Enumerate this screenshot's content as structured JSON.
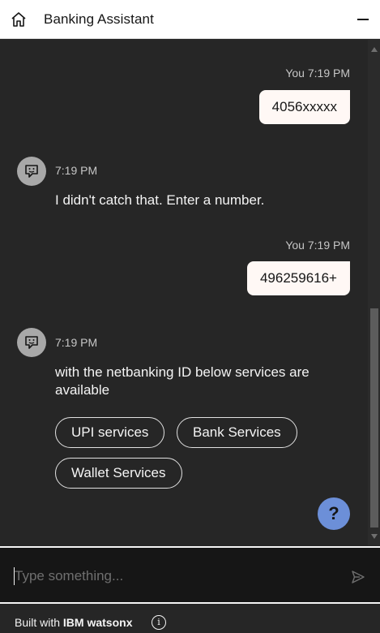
{
  "header": {
    "title": "Banking Assistant",
    "home_icon": "home-icon",
    "minimize_icon": "minimize-icon"
  },
  "messages": [
    {
      "from": "user",
      "sender": "You",
      "time": "7:19 PM",
      "text": "4056xxxxx"
    },
    {
      "from": "bot",
      "time": "7:19 PM",
      "text": "I didn't catch that. Enter a number."
    },
    {
      "from": "user",
      "sender": "You",
      "time": "7:19 PM",
      "text": "496259616+"
    },
    {
      "from": "bot",
      "time": "7:19 PM",
      "text": "with the netbanking ID below services are available"
    }
  ],
  "options": [
    "UPI services",
    "Bank Services",
    "Wallet Services"
  ],
  "help": {
    "label": "?"
  },
  "input": {
    "placeholder": "Type something..."
  },
  "footer": {
    "prefix": "Built with ",
    "brand": "IBM watsonx",
    "info_label": "i"
  },
  "colors": {
    "chat_bg": "#262626",
    "user_bubble": "#fff8f5",
    "help_button": "#6c8fd8",
    "avatar": "#a8a8a8"
  }
}
